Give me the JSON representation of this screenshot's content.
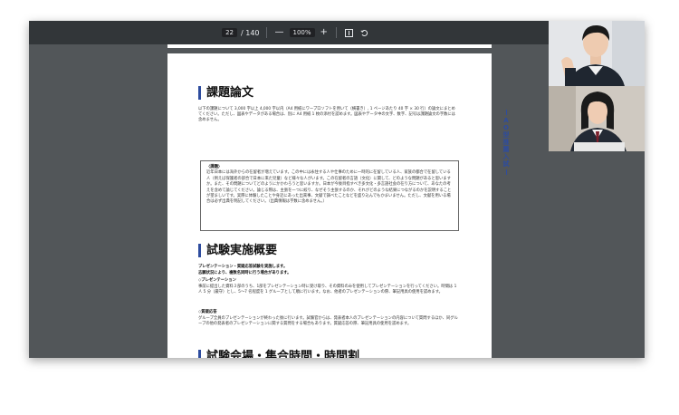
{
  "toolbar": {
    "page_current": "22",
    "page_total": "/ 140",
    "zoom_out": "—",
    "zoom": "100%",
    "zoom_in": "+"
  },
  "document": {
    "section1_title": "課題論文",
    "section1_body": "以下の課題について 3,000 字以上 4,000 字以内（A4 用紙にワープロソフトを用いて（横書き）, 1 ページあたり 40 字 × 30 行）の論文にまとめてください。ただし、図表やデータがある場合は、別に A4 用紙 1 枚の添付を認めます。図表やデータ中の文字、数字、記号は課題論文の字数には含めません。",
    "box_heading": "〈課題〉",
    "box_body": "近年日本には海外からの在留者が増えています。この中には永住する人や仕事のために一時的に在留している人、家族の都合で在留している人（例えば保護者の部合で日本に来た児童）など様々な人がいます。この在留者の言語（文化）に関して、どのような問題があると思いますか。また、その問題についてどのようにかかわろうと思いますか。日本が今後目指すべき多文化・多言語社会の在り方について、あなたの考えを含めて論じてください。論じる際は、主張を一つに絞り、なぜそう主張するのか、それがどのような結果につながるのかを説明することが望ましいです。実際に体験したことや身近にあった出来事、文献で調べたことなどを盛り込んでもかまいません。ただし、文献を用いる場合は必ず出典を明記してください。（出典情報は字数に含めません。）",
    "section2_title": "試験実施概要",
    "section2_lead1": "プレゼンテーション・質疑応答試験を実施します。",
    "section2_lead2": "志願状況により、複数名同時に行う場合があります。",
    "sub1_heading": "◇プレゼンテーション",
    "sub1_body": "事前に提出した資料３部のうち、1部をプレゼンテーション時に受け取り、その資料のみを使用してプレゼンテーションを行ってください。時間は 1 人 5 分（厳守）とし、5～7 名程度を 1 グループとして順に行います。なお、他者のプレゼンテーションの際、筆記用具の使用を認めます。",
    "sub2_heading": "◇質疑応答",
    "sub2_body": "グループ全員のプレゼンテーションが終わった後に行います。試験官からは、発表者本人のプレゼンテーションの内容について質問するほか、同グループの他の発表者のプレゼンテーションに関する質問をする場合もあります。質疑応答の際、筆記用具の使用を認めます。",
    "section3_title": "試験会場・集合時間・時間割",
    "side_tab_chars": [
      "A",
      "O",
      "型",
      "推",
      "薦",
      "入",
      "試"
    ]
  }
}
